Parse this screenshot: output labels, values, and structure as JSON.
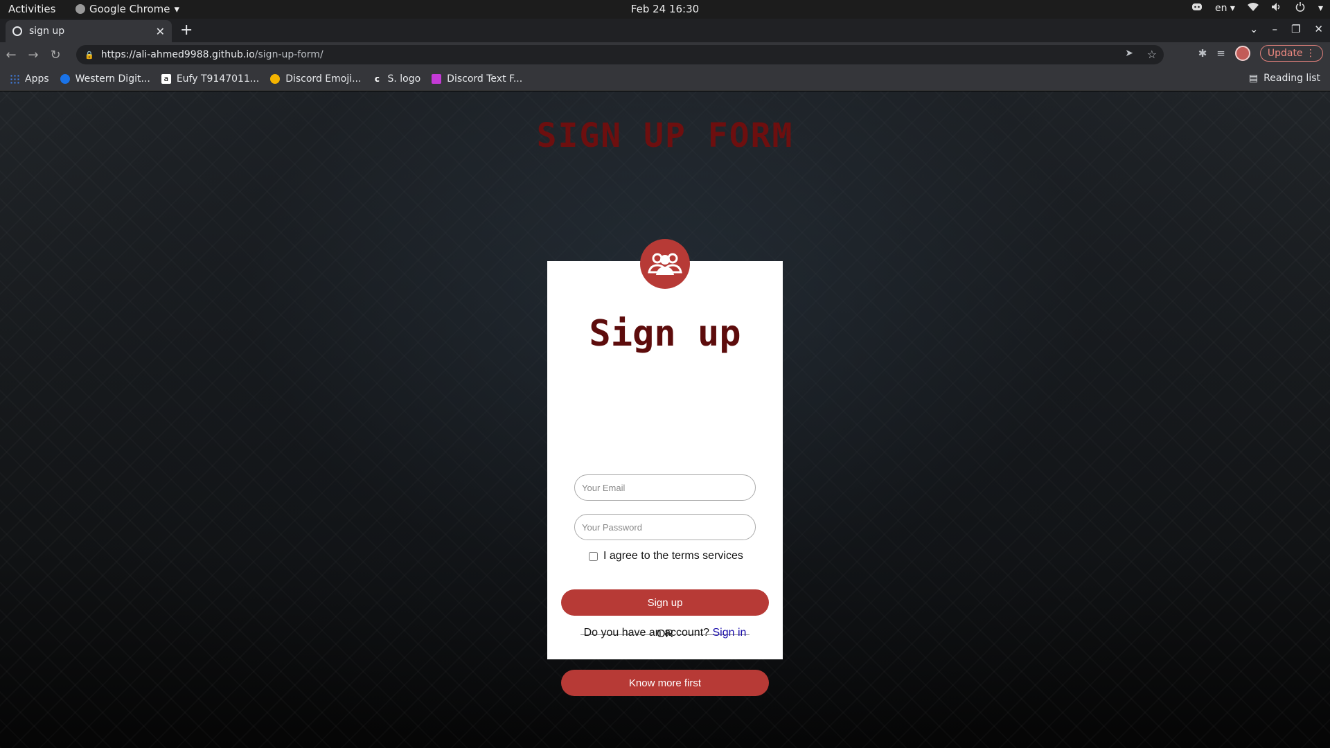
{
  "system": {
    "activities": "Activities",
    "app_name": "Google Chrome",
    "clock": "Feb 24  16:30",
    "language": "en"
  },
  "browser": {
    "tab_title": "sign up",
    "url_host": "https://ali-ahmed9988.github.io",
    "url_path": "/sign-up-form/",
    "update_label": "Update",
    "bookmarks": [
      {
        "label": "Apps",
        "icon": "apps-grid-icon",
        "color": "#4285f4"
      },
      {
        "label": "Western Digit...",
        "icon": "western-digital-icon",
        "color": "#1a73e8"
      },
      {
        "label": "Eufy T9147011...",
        "icon": "amazon-icon",
        "color": "#ffffff"
      },
      {
        "label": "Discord Emoji...",
        "icon": "emoji-icon",
        "color": "#f4b400"
      },
      {
        "label": "S. logo",
        "icon": "c-logo-icon",
        "color": "#000000"
      },
      {
        "label": "Discord Text F...",
        "icon": "discord-text-icon",
        "color": "#c43ad6"
      }
    ],
    "reading_list": "Reading list"
  },
  "page": {
    "heading": "SIGN UP FORM",
    "card_title": "Sign up",
    "email_placeholder": "Your Email",
    "password_placeholder": "Your Password",
    "terms_label": "I agree to the terms services",
    "signup_button": "Sign up",
    "or_text": "OR",
    "know_more_button": "Know more first",
    "account_text": "Do you have an account?",
    "signin_link": "Sign in",
    "accent_color": "#b73a36",
    "title_color": "#6d0f0f"
  }
}
